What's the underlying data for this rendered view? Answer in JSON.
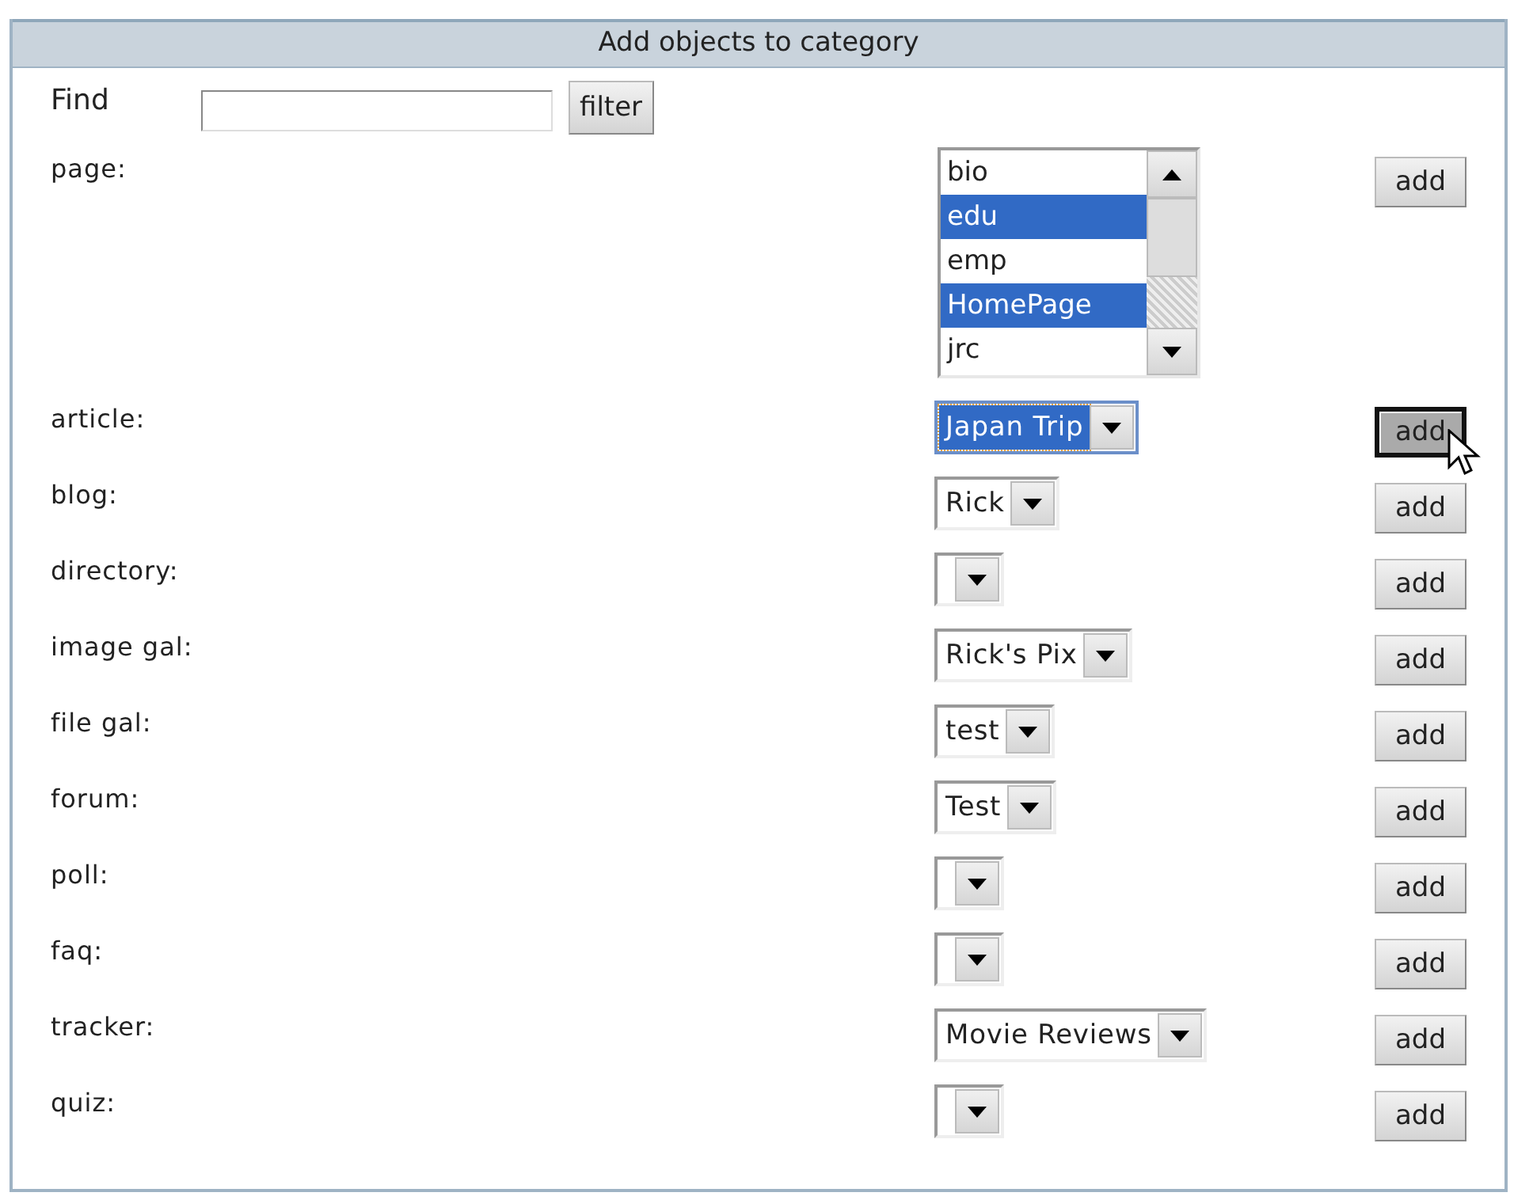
{
  "panel": {
    "title": "Add objects to category"
  },
  "find": {
    "label": "Find",
    "button": "filter"
  },
  "categories": [
    {
      "label": "page:",
      "kind": "listbox",
      "options": [
        {
          "text": "bio",
          "selected": false
        },
        {
          "text": "edu",
          "selected": true
        },
        {
          "text": "emp",
          "selected": false
        },
        {
          "text": "HomePage",
          "selected": true
        },
        {
          "text": "jrc",
          "selected": false
        }
      ],
      "button": "add",
      "pressed": false
    },
    {
      "label": "article:",
      "kind": "dropdown",
      "value": "Japan Trip",
      "focused": true,
      "button": "add",
      "pressed": true
    },
    {
      "label": "blog:",
      "kind": "dropdown",
      "value": "Rick",
      "focused": false,
      "button": "add",
      "pressed": false
    },
    {
      "label": "directory:",
      "kind": "dropdown",
      "button": "add",
      "pressed": false
    },
    {
      "label": "image gal:",
      "kind": "dropdown",
      "value": "Rick's Pix",
      "focused": false,
      "button": "add",
      "pressed": false
    },
    {
      "label": "file gal:",
      "kind": "dropdown",
      "value": "test",
      "focused": false,
      "button": "add",
      "pressed": false
    },
    {
      "label": "forum:",
      "kind": "dropdown",
      "value": "Test",
      "focused": false,
      "button": "add",
      "pressed": false
    },
    {
      "label": "poll:",
      "kind": "dropdown",
      "button": "add",
      "pressed": false
    },
    {
      "label": "faq:",
      "kind": "dropdown",
      "button": "add",
      "pressed": false
    },
    {
      "label": "tracker:",
      "kind": "dropdown",
      "value": "Movie Reviews",
      "focused": false,
      "button": "add",
      "pressed": false
    },
    {
      "label": "quiz:",
      "kind": "dropdown",
      "button": "add",
      "pressed": false
    }
  ]
}
